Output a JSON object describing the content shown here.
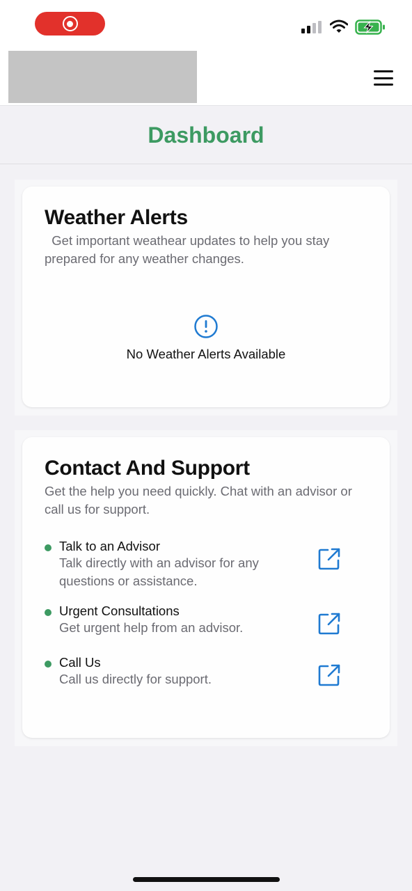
{
  "status_bar": {
    "recording_indicator": "record-icon",
    "signal": "cellular-signal-icon",
    "wifi": "wifi-icon",
    "battery": "battery-charging-icon"
  },
  "header": {
    "logo": "logo-placeholder",
    "menu_icon": "hamburger-menu-icon"
  },
  "page": {
    "title": "Dashboard"
  },
  "weather_alerts": {
    "title": "Weather Alerts",
    "description": "  Get important weathear updates to help you stay prepared for any weather changes.",
    "empty_icon": "alert-circle-icon",
    "empty_message": "No Weather Alerts Available"
  },
  "contact_support": {
    "title": "Contact And Support",
    "description": "Get the help you need quickly. Chat with an advisor or call us for support.",
    "items": [
      {
        "title": "Talk to an Advisor",
        "description": "Talk directly with an advisor for any questions or assistance.",
        "icon": "external-link-icon"
      },
      {
        "title": "Urgent Consultations",
        "description": "Get urgent help from an advisor.",
        "icon": "external-link-icon"
      },
      {
        "title": "Call Us",
        "description": "Call us directly for support.",
        "icon": "external-link-icon"
      }
    ]
  },
  "colors": {
    "accent_green": "#3d9a62",
    "link_blue": "#1f7ad1",
    "record_red": "#e2312b",
    "background": "#f2f1f5"
  }
}
